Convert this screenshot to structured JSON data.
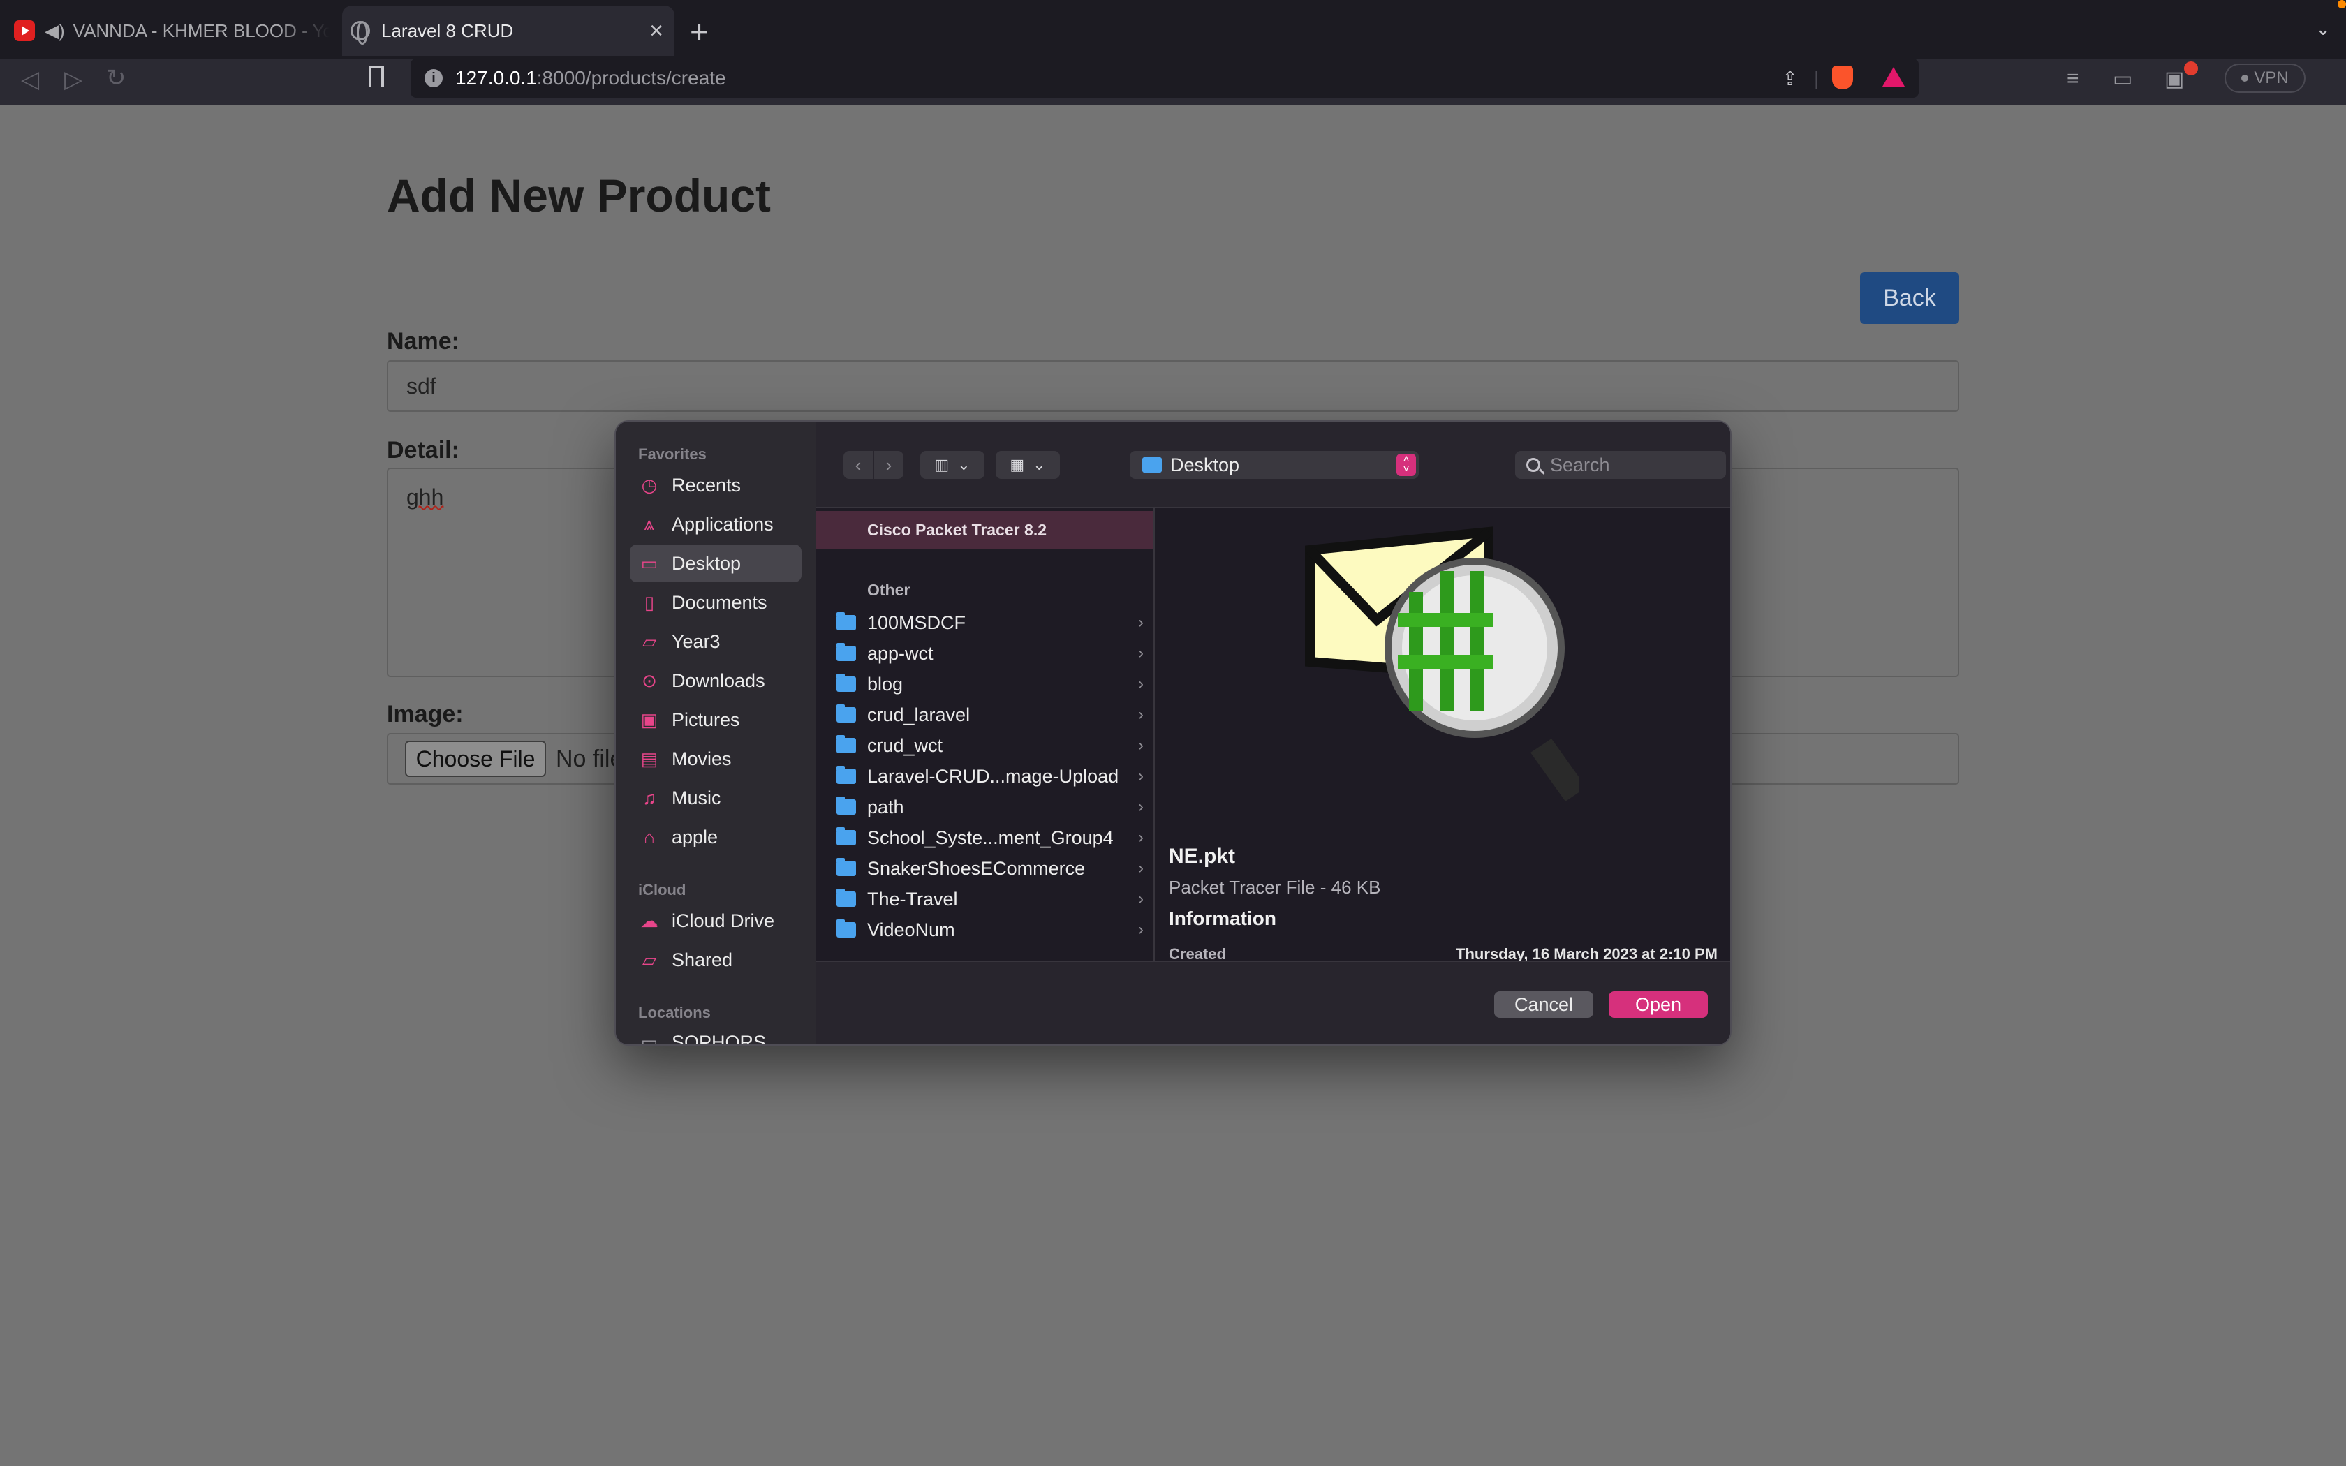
{
  "browser": {
    "tabs": [
      {
        "label": "VANNDA - KHMER BLOOD - You",
        "active": false
      },
      {
        "label": "Laravel 8 CRUD",
        "active": true
      }
    ],
    "url": {
      "host": "127.0.0.1",
      "path": ":8000/products/create"
    },
    "vpn_label": "VPN"
  },
  "page": {
    "title": "Add New Product",
    "back_label": "Back",
    "name_label": "Name:",
    "name_value": "sdf",
    "detail_label": "Detail:",
    "detail_value": "ghh",
    "image_label": "Image:",
    "choose_file_label": "Choose File",
    "no_file_label": "No file"
  },
  "dialog": {
    "sidebar": {
      "favorites_header": "Favorites",
      "favorites": [
        {
          "label": "Recents",
          "icon": "clock-icon"
        },
        {
          "label": "Applications",
          "icon": "applications-icon"
        },
        {
          "label": "Desktop",
          "icon": "desktop-icon",
          "selected": true
        },
        {
          "label": "Documents",
          "icon": "document-icon"
        },
        {
          "label": "Year3",
          "icon": "folder-icon"
        },
        {
          "label": "Downloads",
          "icon": "download-icon"
        },
        {
          "label": "Pictures",
          "icon": "pictures-icon"
        },
        {
          "label": "Movies",
          "icon": "movies-icon"
        },
        {
          "label": "Music",
          "icon": "music-icon"
        },
        {
          "label": "apple",
          "icon": "home-icon"
        }
      ],
      "icloud_header": "iCloud",
      "icloud": [
        {
          "label": "iCloud Drive",
          "icon": "cloud-icon"
        },
        {
          "label": "Shared",
          "icon": "shared-folder-icon"
        }
      ],
      "locations_header": "Locations",
      "locations": [
        {
          "label": "SOPHORS",
          "icon": "computer-icon"
        }
      ]
    },
    "toolbar": {
      "location": "Desktop",
      "search_placeholder": "Search"
    },
    "column": {
      "app_item": "Cisco Packet Tracer 8.2",
      "section": "Other",
      "folders": [
        "100MSDCF",
        "app-wct",
        "blog",
        "crud_laravel",
        "crud_wct",
        "Laravel-CRUD...mage-Upload",
        "path",
        "School_Syste...ment_Group4",
        "SnakerShoesECommerce",
        "The-Travel",
        "VideoNum"
      ]
    },
    "preview": {
      "file_name": "NE.pkt",
      "file_kind": "Packet Tracer File - 46 KB",
      "info_title": "Information",
      "created_label": "Created",
      "created_value": "Thursday, 16 March 2023 at 2:10 PM"
    },
    "cancel_label": "Cancel",
    "open_label": "Open"
  },
  "colors": {
    "accent": "#d6307c",
    "folder_blue": "#4aa3ee",
    "back_button": "#1f4a82"
  }
}
